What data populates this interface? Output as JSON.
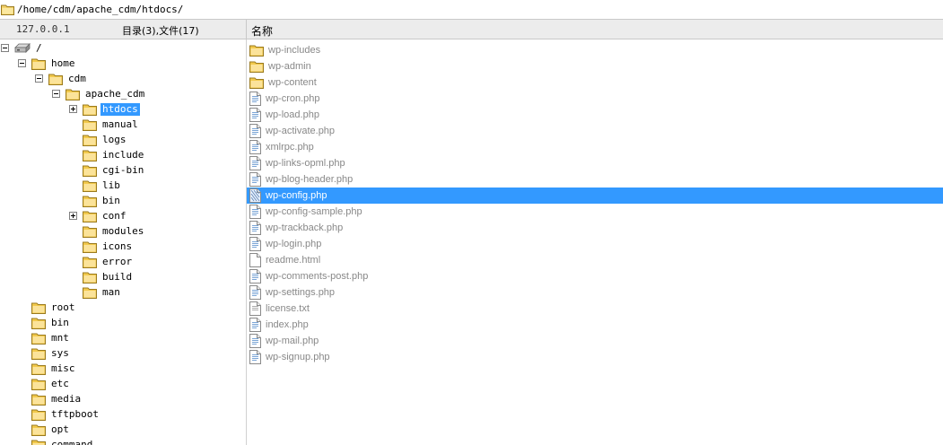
{
  "path_bar": {
    "path": "/home/cdm/apache_cdm/htdocs/"
  },
  "header": {
    "host": "127.0.0.1",
    "counts": "目录(3),文件(17)",
    "name_column": "名称"
  },
  "tree": {
    "root_label": "/",
    "items": [
      {
        "label": "home",
        "depth": 1,
        "expander": "minus",
        "selected": false
      },
      {
        "label": "cdm",
        "depth": 2,
        "expander": "minus",
        "selected": false
      },
      {
        "label": "apache_cdm",
        "depth": 3,
        "expander": "minus",
        "selected": false
      },
      {
        "label": "htdocs",
        "depth": 4,
        "expander": "plus",
        "selected": true
      },
      {
        "label": "manual",
        "depth": 4,
        "expander": "none",
        "selected": false
      },
      {
        "label": "logs",
        "depth": 4,
        "expander": "none",
        "selected": false
      },
      {
        "label": "include",
        "depth": 4,
        "expander": "none",
        "selected": false
      },
      {
        "label": "cgi-bin",
        "depth": 4,
        "expander": "none",
        "selected": false
      },
      {
        "label": "lib",
        "depth": 4,
        "expander": "none",
        "selected": false
      },
      {
        "label": "bin",
        "depth": 4,
        "expander": "none",
        "selected": false
      },
      {
        "label": "conf",
        "depth": 4,
        "expander": "plus",
        "selected": false
      },
      {
        "label": "modules",
        "depth": 4,
        "expander": "none",
        "selected": false
      },
      {
        "label": "icons",
        "depth": 4,
        "expander": "none",
        "selected": false
      },
      {
        "label": "error",
        "depth": 4,
        "expander": "none",
        "selected": false
      },
      {
        "label": "build",
        "depth": 4,
        "expander": "none",
        "selected": false
      },
      {
        "label": "man",
        "depth": 4,
        "expander": "none",
        "selected": false
      },
      {
        "label": "root",
        "depth": 1,
        "expander": "none",
        "selected": false
      },
      {
        "label": "bin",
        "depth": 1,
        "expander": "none",
        "selected": false
      },
      {
        "label": "mnt",
        "depth": 1,
        "expander": "none",
        "selected": false
      },
      {
        "label": "sys",
        "depth": 1,
        "expander": "none",
        "selected": false
      },
      {
        "label": "misc",
        "depth": 1,
        "expander": "none",
        "selected": false
      },
      {
        "label": "etc",
        "depth": 1,
        "expander": "none",
        "selected": false
      },
      {
        "label": "media",
        "depth": 1,
        "expander": "none",
        "selected": false
      },
      {
        "label": "tftpboot",
        "depth": 1,
        "expander": "none",
        "selected": false
      },
      {
        "label": "opt",
        "depth": 1,
        "expander": "none",
        "selected": false
      },
      {
        "label": "command",
        "depth": 1,
        "expander": "none",
        "selected": false
      }
    ]
  },
  "files": [
    {
      "name": "wp-includes",
      "type": "folder",
      "selected": false
    },
    {
      "name": "wp-admin",
      "type": "folder",
      "selected": false
    },
    {
      "name": "wp-content",
      "type": "folder",
      "selected": false
    },
    {
      "name": "wp-cron.php",
      "type": "php",
      "selected": false
    },
    {
      "name": "wp-load.php",
      "type": "php",
      "selected": false
    },
    {
      "name": "wp-activate.php",
      "type": "php",
      "selected": false
    },
    {
      "name": "xmlrpc.php",
      "type": "php",
      "selected": false
    },
    {
      "name": "wp-links-opml.php",
      "type": "php",
      "selected": false
    },
    {
      "name": "wp-blog-header.php",
      "type": "php",
      "selected": false
    },
    {
      "name": "wp-config.php",
      "type": "php",
      "selected": true
    },
    {
      "name": "wp-config-sample.php",
      "type": "php",
      "selected": false
    },
    {
      "name": "wp-trackback.php",
      "type": "php",
      "selected": false
    },
    {
      "name": "wp-login.php",
      "type": "php",
      "selected": false
    },
    {
      "name": "readme.html",
      "type": "html",
      "selected": false
    },
    {
      "name": "wp-comments-post.php",
      "type": "php",
      "selected": false
    },
    {
      "name": "wp-settings.php",
      "type": "php",
      "selected": false
    },
    {
      "name": "license.txt",
      "type": "txt",
      "selected": false
    },
    {
      "name": "index.php",
      "type": "php",
      "selected": false
    },
    {
      "name": "wp-mail.php",
      "type": "php",
      "selected": false
    },
    {
      "name": "wp-signup.php",
      "type": "php",
      "selected": false
    }
  ],
  "colors": {
    "selection": "#3399ff",
    "folder": "#f2c94c",
    "file_text": "#888888"
  }
}
